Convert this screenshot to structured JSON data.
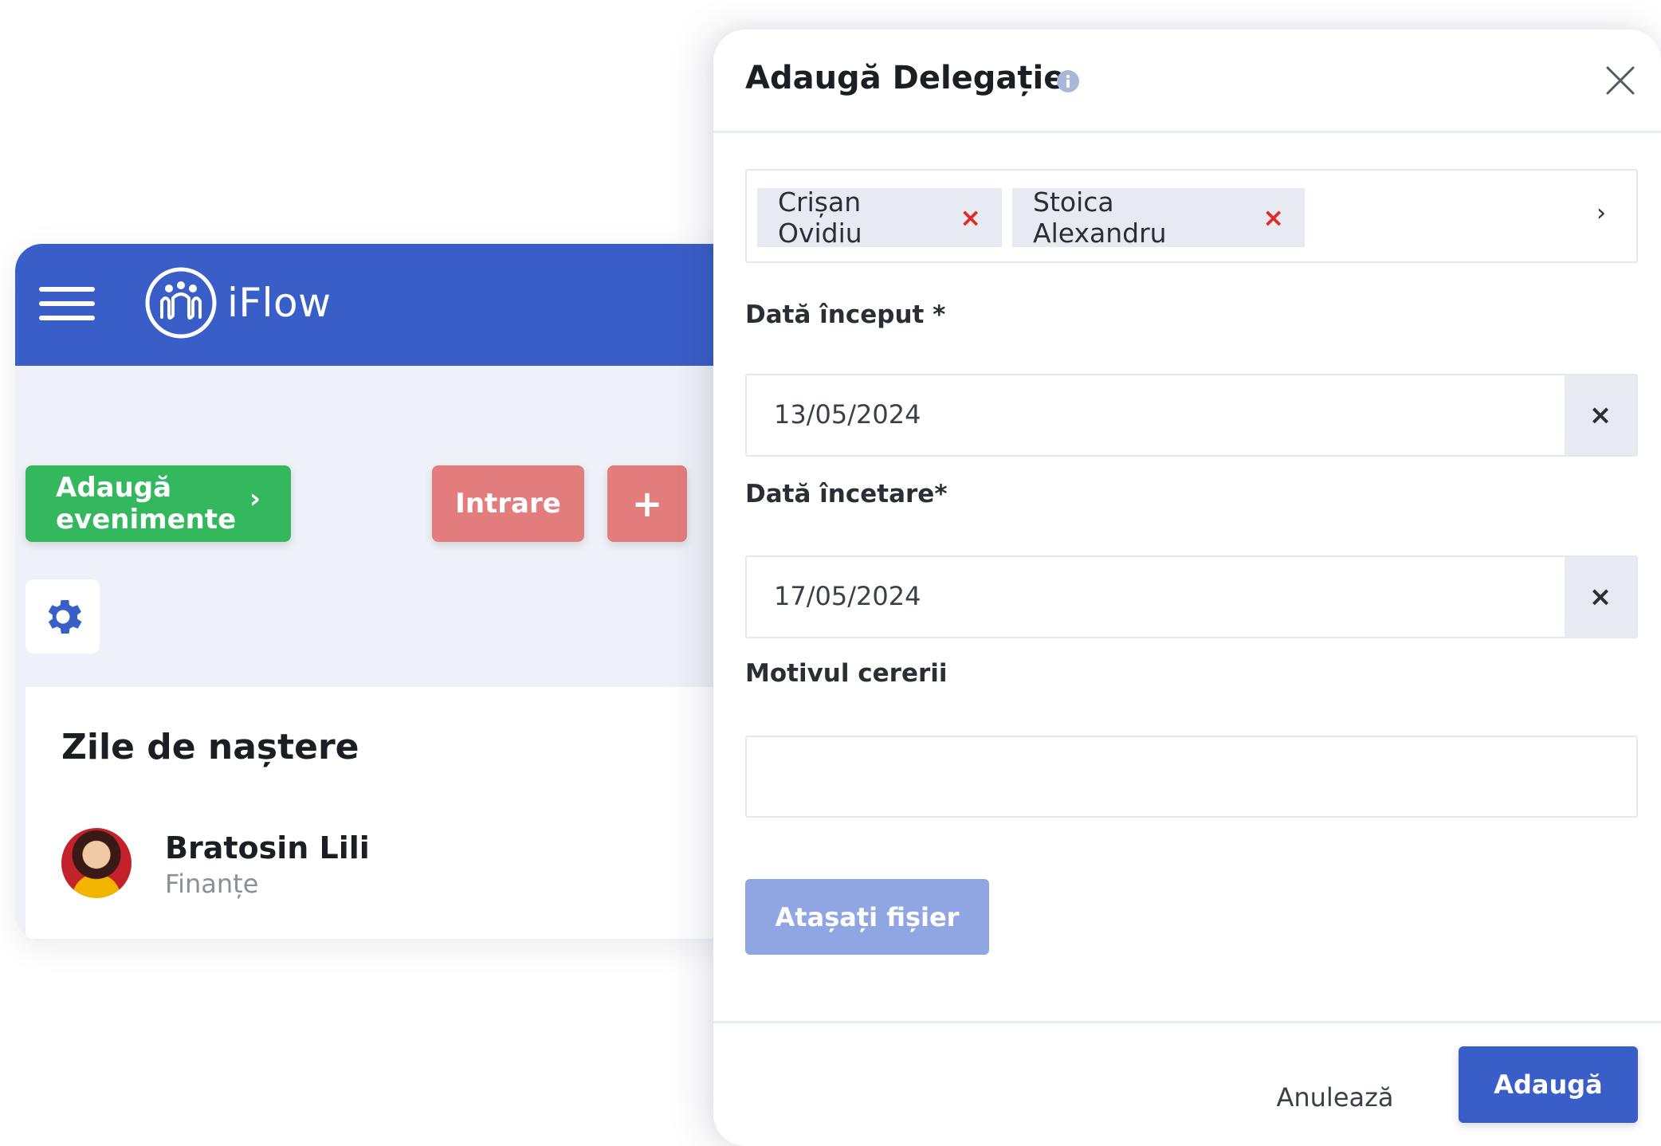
{
  "app": {
    "brand": "iFlow",
    "actions": {
      "add_events_label": "Adaugă evenimente",
      "add_events_chevron": "›",
      "entry_label": "Intrare",
      "plus_label": "+"
    },
    "birthdays": {
      "title": "Zile de naștere",
      "people": [
        {
          "name": "Bratosin Lili",
          "department": "Finanțe"
        }
      ]
    }
  },
  "modal": {
    "title": "Adaugă Delegație",
    "selected_people": [
      {
        "name": "Crișan Ovidiu",
        "remove": "×"
      },
      {
        "name": "Stoica Alexandru",
        "remove": "×"
      }
    ],
    "selector_chevron": "›",
    "start_date": {
      "label": "Dată început *",
      "value": "13/05/2024",
      "clear": "×"
    },
    "end_date": {
      "label": "Dată încetare*",
      "value": "17/05/2024",
      "clear": "×"
    },
    "reason": {
      "label": "Motivul cererii",
      "value": ""
    },
    "attach_label": "Atașați fișier",
    "cancel_label": "Anulează",
    "submit_label": "Adaugă"
  },
  "colors": {
    "primary": "#3a5ec7",
    "success": "#33b85e",
    "danger_soft": "#e37c7c",
    "attach_disabled": "#90a6e2",
    "tag_remove": "#e02a2a"
  },
  "icons": [
    "menu-icon",
    "iflow-logo-icon",
    "gear-icon",
    "info-icon",
    "close-icon",
    "chevron-right-icon"
  ]
}
